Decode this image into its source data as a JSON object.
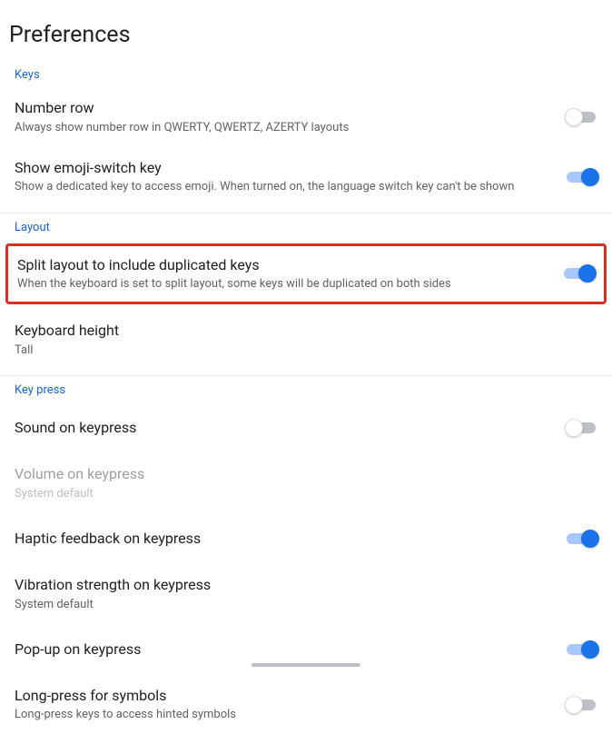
{
  "title": "Preferences",
  "sections": {
    "keys": {
      "header": "Keys",
      "number_row": {
        "title": "Number row",
        "sub": "Always show number row in QWERTY, QWERTZ, AZERTY layouts"
      },
      "emoji_switch": {
        "title": "Show emoji-switch key",
        "sub": "Show a dedicated key to access emoji. When turned on, the language switch key can't be shown"
      }
    },
    "layout": {
      "header": "Layout",
      "split": {
        "title": "Split layout to include duplicated keys",
        "sub": "When the keyboard is set to split layout, some keys will be duplicated on both sides"
      },
      "kb_height": {
        "title": "Keyboard height",
        "sub": "Tall"
      }
    },
    "keypress": {
      "header": "Key press",
      "sound": {
        "title": "Sound on keypress"
      },
      "volume": {
        "title": "Volume on keypress",
        "sub": "System default"
      },
      "haptic": {
        "title": "Haptic feedback on keypress"
      },
      "vibration": {
        "title": "Vibration strength on keypress",
        "sub": "System default"
      },
      "popup": {
        "title": "Pop-up on keypress"
      },
      "longpress": {
        "title": "Long-press for symbols",
        "sub": "Long-press keys to access hinted symbols"
      }
    }
  },
  "toggles": {
    "number_row": false,
    "emoji_switch": true,
    "split": true,
    "sound": false,
    "haptic": true,
    "popup": true,
    "longpress": false
  }
}
